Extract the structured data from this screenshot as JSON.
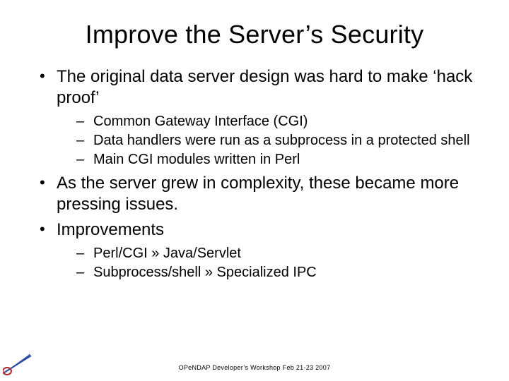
{
  "title": "Improve the Server’s Security",
  "bullets": [
    {
      "text": "The original data server design was hard to make ‘hack proof’",
      "sub": [
        "Common Gateway Interface (CGI)",
        "Data handlers were run as a subprocess in a protected shell",
        "Main CGI modules written in Perl"
      ]
    },
    {
      "text": "As the server grew in complexity, these became more pressing issues.",
      "sub": []
    },
    {
      "text": "Improvements",
      "sub": [
        "Perl/CGI » Java/Servlet",
        "Subprocess/shell » Specialized IPC"
      ]
    }
  ],
  "footer": "OPeNDAP Developer’s Workshop Feb 21-23 2007"
}
